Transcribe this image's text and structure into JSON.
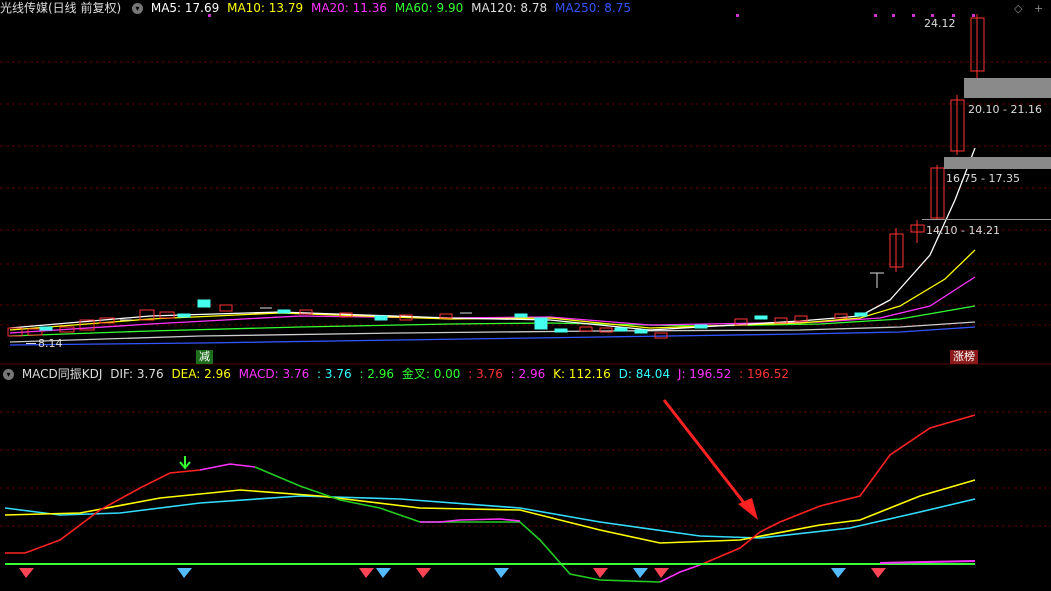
{
  "top_header": {
    "stock_name": "光线传媒(日线 前复权)",
    "ma_items": [
      {
        "label": "MA5: 17.69",
        "color": "#ffffff"
      },
      {
        "label": "MA10: 13.79",
        "color": "#ffff00"
      },
      {
        "label": "MA20: 11.36",
        "color": "#ff33ff"
      },
      {
        "label": "MA60: 9.90",
        "color": "#33ff33"
      },
      {
        "label": "MA120: 8.78",
        "color": "#dddddd"
      },
      {
        "label": "MA250: 8.75",
        "color": "#3355ff"
      }
    ]
  },
  "indicator_header": {
    "name": "MACD同振KDJ",
    "items": [
      {
        "label": "DIF: 3.76",
        "color": "#dddddd"
      },
      {
        "label": "DEA: 2.96",
        "color": "#ffff00"
      },
      {
        "label": "MACD: 3.76",
        "color": "#ff33ff"
      },
      {
        "label": ": 3.76",
        "color": "#33ffff"
      },
      {
        "label": ": 2.96",
        "color": "#33ff33"
      },
      {
        "label": "金叉: 0.00",
        "color": "#33ff33"
      },
      {
        "label": ": 3.76",
        "color": "#ff3333"
      },
      {
        "label": ": 2.96",
        "color": "#ff33ff"
      },
      {
        "label": "K: 112.16",
        "color": "#ffff00"
      },
      {
        "label": "D: 84.04",
        "color": "#33ffff"
      },
      {
        "label": "J: 196.52",
        "color": "#ff33ff"
      },
      {
        "label": ": 196.52",
        "color": "#ff3333"
      }
    ]
  },
  "price_labels": {
    "high": "24.12",
    "low": "8.14",
    "zone1": "20.10 - 21.16",
    "zone2": "16.75 - 17.35",
    "zone3": "14.10 - 14.21"
  },
  "tags": {
    "reduce": "减",
    "limit_list": "涨榜"
  },
  "window_controls": {
    "diamond": "◇",
    "plus": "+"
  },
  "chart_data": {
    "type": "candlestick",
    "note": "daily candles, last sessions show sharp rally from ~8 to 24.12",
    "high_price": 24.12,
    "low_price": 8.14,
    "ma_values_last": {
      "MA5": 17.69,
      "MA10": 13.79,
      "MA20": 11.36,
      "MA60": 9.9,
      "MA120": 8.78,
      "MA250": 8.75
    },
    "macd_last": {
      "DIF": 3.76,
      "DEA": 2.96,
      "MACD": 3.76
    },
    "kdj_last": {
      "K": 112.16,
      "D": 84.04,
      "J": 196.52
    }
  }
}
